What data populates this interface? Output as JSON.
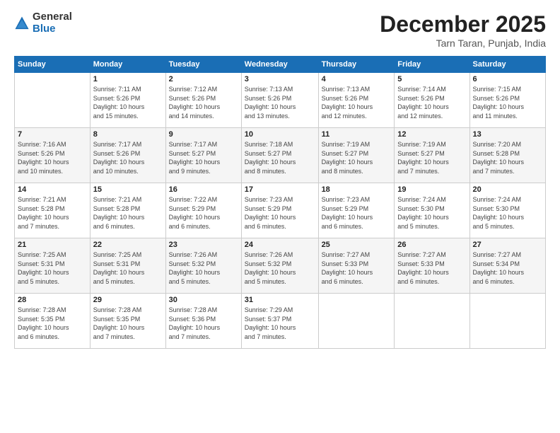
{
  "logo": {
    "general": "General",
    "blue": "Blue"
  },
  "header": {
    "month": "December 2025",
    "location": "Tarn Taran, Punjab, India"
  },
  "weekdays": [
    "Sunday",
    "Monday",
    "Tuesday",
    "Wednesday",
    "Thursday",
    "Friday",
    "Saturday"
  ],
  "weeks": [
    [
      {
        "day": "",
        "info": ""
      },
      {
        "day": "1",
        "info": "Sunrise: 7:11 AM\nSunset: 5:26 PM\nDaylight: 10 hours\nand 15 minutes."
      },
      {
        "day": "2",
        "info": "Sunrise: 7:12 AM\nSunset: 5:26 PM\nDaylight: 10 hours\nand 14 minutes."
      },
      {
        "day": "3",
        "info": "Sunrise: 7:13 AM\nSunset: 5:26 PM\nDaylight: 10 hours\nand 13 minutes."
      },
      {
        "day": "4",
        "info": "Sunrise: 7:13 AM\nSunset: 5:26 PM\nDaylight: 10 hours\nand 12 minutes."
      },
      {
        "day": "5",
        "info": "Sunrise: 7:14 AM\nSunset: 5:26 PM\nDaylight: 10 hours\nand 12 minutes."
      },
      {
        "day": "6",
        "info": "Sunrise: 7:15 AM\nSunset: 5:26 PM\nDaylight: 10 hours\nand 11 minutes."
      }
    ],
    [
      {
        "day": "7",
        "info": "Sunrise: 7:16 AM\nSunset: 5:26 PM\nDaylight: 10 hours\nand 10 minutes."
      },
      {
        "day": "8",
        "info": "Sunrise: 7:17 AM\nSunset: 5:26 PM\nDaylight: 10 hours\nand 10 minutes."
      },
      {
        "day": "9",
        "info": "Sunrise: 7:17 AM\nSunset: 5:27 PM\nDaylight: 10 hours\nand 9 minutes."
      },
      {
        "day": "10",
        "info": "Sunrise: 7:18 AM\nSunset: 5:27 PM\nDaylight: 10 hours\nand 8 minutes."
      },
      {
        "day": "11",
        "info": "Sunrise: 7:19 AM\nSunset: 5:27 PM\nDaylight: 10 hours\nand 8 minutes."
      },
      {
        "day": "12",
        "info": "Sunrise: 7:19 AM\nSunset: 5:27 PM\nDaylight: 10 hours\nand 7 minutes."
      },
      {
        "day": "13",
        "info": "Sunrise: 7:20 AM\nSunset: 5:28 PM\nDaylight: 10 hours\nand 7 minutes."
      }
    ],
    [
      {
        "day": "14",
        "info": "Sunrise: 7:21 AM\nSunset: 5:28 PM\nDaylight: 10 hours\nand 7 minutes."
      },
      {
        "day": "15",
        "info": "Sunrise: 7:21 AM\nSunset: 5:28 PM\nDaylight: 10 hours\nand 6 minutes."
      },
      {
        "day": "16",
        "info": "Sunrise: 7:22 AM\nSunset: 5:29 PM\nDaylight: 10 hours\nand 6 minutes."
      },
      {
        "day": "17",
        "info": "Sunrise: 7:23 AM\nSunset: 5:29 PM\nDaylight: 10 hours\nand 6 minutes."
      },
      {
        "day": "18",
        "info": "Sunrise: 7:23 AM\nSunset: 5:29 PM\nDaylight: 10 hours\nand 6 minutes."
      },
      {
        "day": "19",
        "info": "Sunrise: 7:24 AM\nSunset: 5:30 PM\nDaylight: 10 hours\nand 5 minutes."
      },
      {
        "day": "20",
        "info": "Sunrise: 7:24 AM\nSunset: 5:30 PM\nDaylight: 10 hours\nand 5 minutes."
      }
    ],
    [
      {
        "day": "21",
        "info": "Sunrise: 7:25 AM\nSunset: 5:31 PM\nDaylight: 10 hours\nand 5 minutes."
      },
      {
        "day": "22",
        "info": "Sunrise: 7:25 AM\nSunset: 5:31 PM\nDaylight: 10 hours\nand 5 minutes."
      },
      {
        "day": "23",
        "info": "Sunrise: 7:26 AM\nSunset: 5:32 PM\nDaylight: 10 hours\nand 5 minutes."
      },
      {
        "day": "24",
        "info": "Sunrise: 7:26 AM\nSunset: 5:32 PM\nDaylight: 10 hours\nand 5 minutes."
      },
      {
        "day": "25",
        "info": "Sunrise: 7:27 AM\nSunset: 5:33 PM\nDaylight: 10 hours\nand 6 minutes."
      },
      {
        "day": "26",
        "info": "Sunrise: 7:27 AM\nSunset: 5:33 PM\nDaylight: 10 hours\nand 6 minutes."
      },
      {
        "day": "27",
        "info": "Sunrise: 7:27 AM\nSunset: 5:34 PM\nDaylight: 10 hours\nand 6 minutes."
      }
    ],
    [
      {
        "day": "28",
        "info": "Sunrise: 7:28 AM\nSunset: 5:35 PM\nDaylight: 10 hours\nand 6 minutes."
      },
      {
        "day": "29",
        "info": "Sunrise: 7:28 AM\nSunset: 5:35 PM\nDaylight: 10 hours\nand 7 minutes."
      },
      {
        "day": "30",
        "info": "Sunrise: 7:28 AM\nSunset: 5:36 PM\nDaylight: 10 hours\nand 7 minutes."
      },
      {
        "day": "31",
        "info": "Sunrise: 7:29 AM\nSunset: 5:37 PM\nDaylight: 10 hours\nand 7 minutes."
      },
      {
        "day": "",
        "info": ""
      },
      {
        "day": "",
        "info": ""
      },
      {
        "day": "",
        "info": ""
      }
    ]
  ]
}
